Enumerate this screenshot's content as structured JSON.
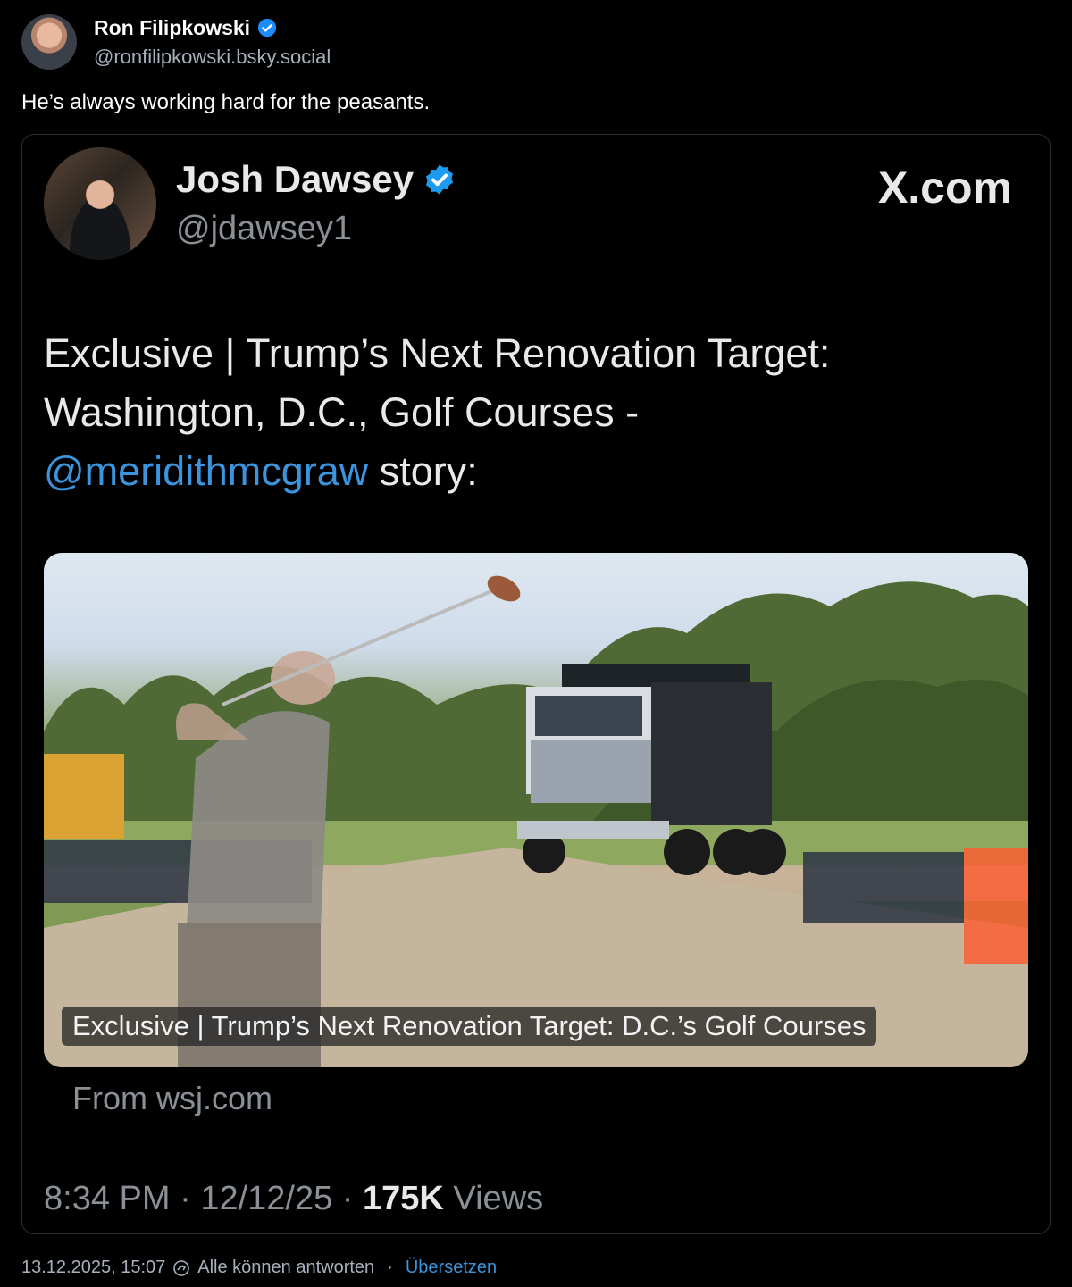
{
  "post": {
    "author_name": "Ron Filipkowski",
    "author_handle": "@ronfilipkowski.bsky.social",
    "text": "He’s always working hard for the peasants.",
    "date": "13.12.2025, 15:07",
    "reply_setting": "Alle können antworten",
    "separator": "·",
    "translate_label": "Übersetzen"
  },
  "embed": {
    "author_name": "Josh Dawsey",
    "author_handle": "@jdawsey1",
    "source_label": "X.com",
    "text_part1": "Exclusive | Trump’s Next Renovation Target: Washington, D.C., Golf Courses -",
    "mention": "@meridithmcgraw",
    "text_part2": " story:",
    "image_caption": "Exclusive | Trump’s Next Renovation Target: D.C.’s Golf Courses",
    "link_source": "From wsj.com",
    "time": "8:34 PM",
    "date": "12/12/25",
    "views_count": "175K",
    "views_label": " Views",
    "dot": " · "
  },
  "colors": {
    "accent": "#3b94dc",
    "muted": "#8b9096",
    "background": "#000000"
  },
  "icons": [
    "verified-badge-icon",
    "reply-setting-icon"
  ]
}
